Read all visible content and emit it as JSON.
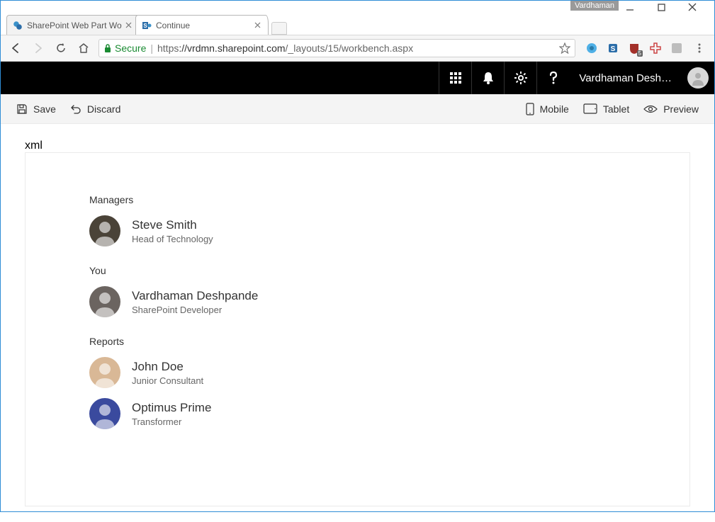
{
  "window": {
    "badge": "Vardhaman"
  },
  "tabs": [
    {
      "label": "SharePoint Web Part Wo",
      "favicon": "sharepoint",
      "active": false
    },
    {
      "label": "Continue",
      "favicon": "sharepoint",
      "active": true
    }
  ],
  "address": {
    "secure_label": "Secure",
    "scheme": "https",
    "host": "://vrdmn.sharepoint.com",
    "path": "/_layouts/15/workbench.aspx"
  },
  "suite": {
    "user_display": "Vardhaman Desh…"
  },
  "commandbar": {
    "save": "Save",
    "discard": "Discard",
    "mobile": "Mobile",
    "tablet": "Tablet",
    "preview": "Preview"
  },
  "content": {
    "sections": [
      {
        "title": "Managers",
        "people": [
          {
            "name": "Steve Smith",
            "title": "Head of Technology",
            "avatar_bg": "#4a4338"
          }
        ]
      },
      {
        "title": "You",
        "people": [
          {
            "name": "Vardhaman Deshpande",
            "title": "SharePoint Developer",
            "avatar_bg": "#6b6460"
          }
        ]
      },
      {
        "title": "Reports",
        "people": [
          {
            "name": "John Doe",
            "title": "Junior Consultant",
            "avatar_bg": "#d9b896"
          },
          {
            "name": "Optimus Prime",
            "title": "Transformer",
            "avatar_bg": "#3a4a9e"
          }
        ]
      }
    ]
  }
}
